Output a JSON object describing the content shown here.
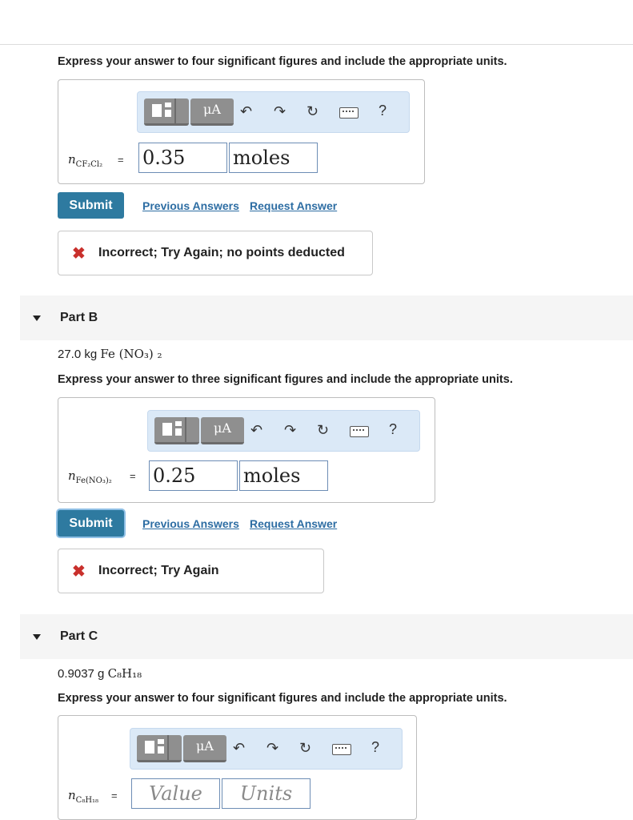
{
  "part_a": {
    "instruction": "Express your answer to four significant figures and include the appropriate units.",
    "variable": {
      "base": "n",
      "subscript": "CF₂Cl₂"
    },
    "equals": "=",
    "value": "0.35",
    "units": "moles",
    "submit_label": "Submit",
    "previous_answers": "Previous Answers",
    "request_answer": "Request Answer",
    "feedback": "Incorrect; Try Again; no points deducted"
  },
  "part_b": {
    "title": "Part B",
    "problem": {
      "quantity": "27.0 kg",
      "formula": "Fe (NO₃) ₂"
    },
    "instruction": "Express your answer to three significant figures and include the appropriate units.",
    "variable": {
      "base": "n",
      "subscript": "Fe(NO₃)₂"
    },
    "equals": "=",
    "value": "0.25",
    "units": "moles",
    "submit_label": "Submit",
    "previous_answers": "Previous Answers",
    "request_answer": "Request Answer",
    "feedback": "Incorrect; Try Again"
  },
  "part_c": {
    "title": "Part C",
    "problem": {
      "quantity": "0.9037 g",
      "formula": "C₈H₁₈"
    },
    "instruction": "Express your answer to four significant figures and include the appropriate units.",
    "variable": {
      "base": "n",
      "subscript": "C₈H₁₈"
    },
    "equals": "=",
    "value_placeholder": "Value",
    "units_placeholder": "Units"
  },
  "toolbar": {
    "mu_label": "μA",
    "help_label": "?",
    "icons": [
      "templates-icon",
      "units-icon",
      "undo-icon",
      "redo-icon",
      "reset-icon",
      "keyboard-icon",
      "help-icon"
    ]
  },
  "colors": {
    "submit": "#2e7aa0",
    "link": "#2d6da3",
    "error": "#c9302c",
    "toolbar_bg": "#dbe9f7"
  }
}
